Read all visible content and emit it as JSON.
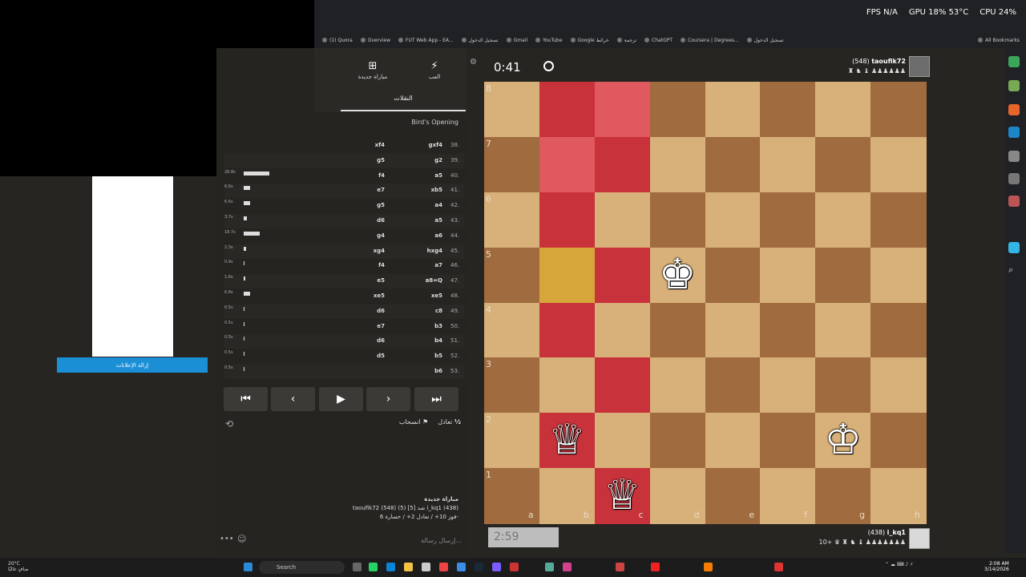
{
  "hud": {
    "fps_label": "FPS",
    "fps_value": "N/A",
    "gpu": "GPU 18% 53°C",
    "cpu": "CPU 24%"
  },
  "bookmarks": [
    "(1) Quora",
    "Overview",
    "FUT Web App - EA...",
    "تسجيل الدخول",
    "Gmail",
    "YouTube",
    "Google خرائط",
    "ترجمة",
    "ChatGPT",
    "Coursera | Degrees...",
    "تسجيل الدخول",
    "All Bookmarks"
  ],
  "ad": {
    "remove_ads_label": "إزالة الإعلانات"
  },
  "nav": {
    "new_game_label": "مباراة جديدة",
    "play_label": "العب"
  },
  "moves_tab_label": "النقلات",
  "opening_name": "Bird's Opening",
  "moves": [
    {
      "num": "38.",
      "white": "gxf4",
      "black": "xf4",
      "time": "",
      "bar": 0
    },
    {
      "num": "39.",
      "white": "g2",
      "black": "g5",
      "time": "",
      "bar": 0
    },
    {
      "num": "40.",
      "white": "a5",
      "black": "f4",
      "time": "28.8s",
      "bar": 0.8
    },
    {
      "num": "41.",
      "white": "xb5",
      "black": "e7",
      "time": "6.6s",
      "bar": 0.2
    },
    {
      "num": "42.",
      "white": "a4",
      "black": "g5",
      "time": "6.6s",
      "bar": 0.2
    },
    {
      "num": "43.",
      "white": "a5",
      "black": "d6",
      "time": "3.7s",
      "bar": 0.1
    },
    {
      "num": "44.",
      "white": "a6",
      "black": "g4",
      "time": "18.7s",
      "bar": 0.5
    },
    {
      "num": "45.",
      "white": "hxg4",
      "black": "xg4",
      "time": "2.3s",
      "bar": 0.07
    },
    {
      "num": "46.",
      "white": "a7",
      "black": "f4",
      "time": "0.9s",
      "bar": 0.03
    },
    {
      "num": "47.",
      "white": "a8=Q",
      "black": "e5",
      "time": "1.6s",
      "bar": 0.05
    },
    {
      "num": "48.",
      "white": "xe5",
      "black": "xe5",
      "time": "6.8s",
      "bar": 0.2
    },
    {
      "num": "49.",
      "white": "c8",
      "black": "d6",
      "time": "0.5s",
      "bar": 0.02
    },
    {
      "num": "50.",
      "white": "b3",
      "black": "e7",
      "time": "0.5s",
      "bar": 0.02
    },
    {
      "num": "51.",
      "white": "b4",
      "black": "d6",
      "time": "0.5s",
      "bar": 0.02
    },
    {
      "num": "52.",
      "white": "b5",
      "black": "d5",
      "time": "0.5s",
      "bar": 0.02
    },
    {
      "num": "53.",
      "white": "b6",
      "black": "",
      "time": "0.5s",
      "bar": 0.02
    }
  ],
  "controls": {
    "first": "⏮",
    "prev": "‹",
    "play": "▶",
    "next": "›",
    "last": "⏭"
  },
  "actions": {
    "draw_label": "تعادل",
    "draw_icon": "½",
    "resign_label": "انسحاب"
  },
  "game_info": {
    "line1": "مباراة جديدة",
    "line2": "taoufik72 (548) (5) [5] ضد i_kq1 (438)",
    "line3": "فوز 10+ / تعادل 2+ / خسارة 6-"
  },
  "chat_placeholder": "إرسال رسالة...",
  "top_player": {
    "name": "taoufik72",
    "rating": "(548)",
    "timer": "0:41"
  },
  "bottom_player": {
    "name": "i_kq1",
    "rating": "(438)",
    "timer": "2:59",
    "material": "10+"
  },
  "board": {
    "ranks": [
      "8",
      "7",
      "6",
      "5",
      "4",
      "3",
      "2",
      "1"
    ],
    "files": [
      "a",
      "b",
      "c",
      "d",
      "e",
      "f",
      "g",
      "h"
    ],
    "light": "#d8b07a",
    "dark": "#a06b3e",
    "highlight": "#c8323a",
    "highlight_light": "#e0595e",
    "last_move": "#d7a63a",
    "pieces": [
      {
        "square": "d5",
        "glyph": "♚",
        "side": "black"
      },
      {
        "square": "b2",
        "glyph": "♕",
        "side": "white"
      },
      {
        "square": "g2",
        "glyph": "♔",
        "side": "white"
      },
      {
        "square": "c1",
        "glyph": "♕",
        "side": "white"
      }
    ]
  },
  "taskbar": {
    "search_placeholder": "Search",
    "time": "2:08 AM",
    "date": "3/14/2026",
    "weather_temp": "20°C",
    "weather_desc": "صافٍ غالبًا"
  }
}
